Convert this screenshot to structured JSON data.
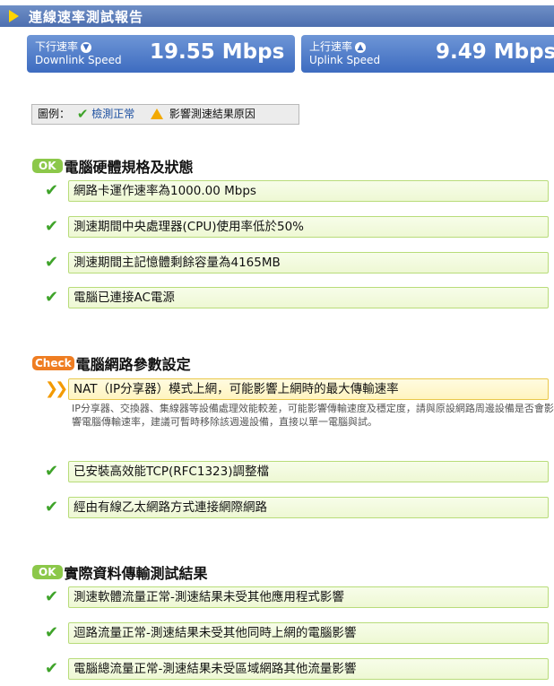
{
  "header": {
    "title": "連線速率測試報告"
  },
  "speed": {
    "downlink": {
      "label_cn": "下行速率",
      "label_en": "Downlink Speed",
      "value": "19.55 Mbps"
    },
    "uplink": {
      "label_cn": "上行速率",
      "label_en": "Uplink Speed",
      "value": "9.49 Mbps"
    }
  },
  "legend": {
    "prefix": "圖例：",
    "normal": "檢測正常",
    "affect": "影響測速結果原因"
  },
  "sections": [
    {
      "badge": "OK",
      "title": "電腦硬體規格及狀態",
      "items": [
        {
          "text": "網路卡運作速率為1000.00 Mbps",
          "status": "ok"
        },
        {
          "text": "測速期間中央處理器(CPU)使用率低於50%",
          "status": "ok"
        },
        {
          "text": "測速期間主記憶體剩餘容量為4165MB",
          "status": "ok"
        },
        {
          "text": "電腦已連接AC電源",
          "status": "ok"
        }
      ]
    },
    {
      "badge": "Check",
      "title": "電腦網路參數設定",
      "items": [
        {
          "text": "NAT（IP分享器）模式上網，可能影響上網時的最大傳輸速率",
          "status": "warn",
          "description": "IP分享器、交換器、集線器等設備處理效能較差，可能影響傳輸速度及穩定度，請與原設網路周邊設備是否會影響電腦傳輸速率，建議可暫時移除該週邊設備，直接以單一電腦與試。"
        },
        {
          "text": "已安裝高效能TCP(RFC1323)調整檔",
          "status": "ok"
        },
        {
          "text": "經由有線乙太網路方式連接網際網路",
          "status": "ok"
        }
      ]
    },
    {
      "badge": "OK",
      "title": "實際資料傳輸測試結果",
      "items": [
        {
          "text": "測速軟體流量正常-測速結果未受其他應用程式影響",
          "status": "ok"
        },
        {
          "text": "迴路流量正常-測速結果未受其他同時上網的電腦影響",
          "status": "ok"
        },
        {
          "text": "電腦總流量正常-測速結果未受區域網路其他流量影響",
          "status": "ok"
        }
      ]
    }
  ],
  "icons": {
    "ok": "check-icon",
    "warn": "double-chevron-icon",
    "legend_warn": "warning-icon",
    "down": "chevron-down-circle-icon",
    "up": "chevron-up-circle-icon"
  },
  "colors": {
    "header_bg": "#4d6fb0",
    "speed_bg": "#3d6cc0",
    "ok_badge": "#8cc84a",
    "check_badge": "#ef7d22",
    "ok_row_bg": "#f0f9d8",
    "warn_row_bg": "#fff6c6"
  }
}
